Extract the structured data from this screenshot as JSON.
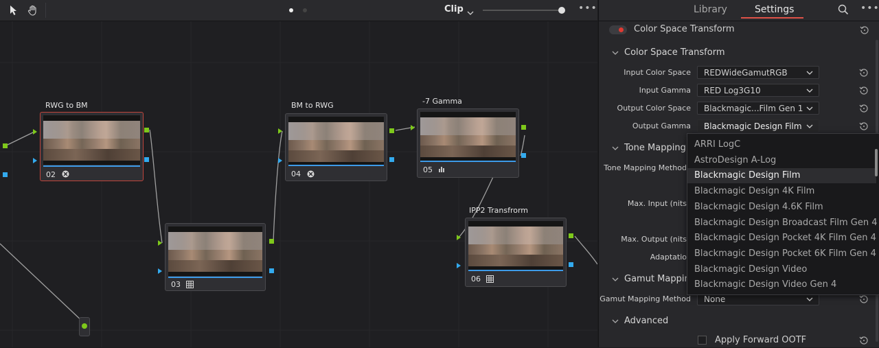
{
  "node_editor": {
    "clip_label": "Clip",
    "more": "•••",
    "nodes": [
      {
        "title": "RWG to BM",
        "number": "02",
        "icon": "fx-icon"
      },
      {
        "title": "",
        "number": "03",
        "icon": "grid-icon"
      },
      {
        "title": "BM to RWG",
        "number": "04",
        "icon": "fx-icon"
      },
      {
        "title": "-7 Gamma",
        "number": "05",
        "icon": "bars-icon"
      },
      {
        "title": "IPP2 Transfrorm",
        "number": "06",
        "icon": "grid-icon"
      }
    ]
  },
  "settings": {
    "tabs": {
      "library": "Library",
      "settings": "Settings"
    },
    "more": "•••",
    "plugin_title": "Color Space Transform",
    "section_cst": "Color Space Transform",
    "input_color_space_label": "Input Color Space",
    "input_color_space_value": "REDWideGamutRGB",
    "input_gamma_label": "Input Gamma",
    "input_gamma_value": "RED Log3G10",
    "output_color_space_label": "Output Color Space",
    "output_color_space_value": "Blackmagic...Film Gen 1",
    "output_gamma_label": "Output Gamma",
    "output_gamma_value": "Blackmagic Design Film",
    "section_tone": "Tone Mapping",
    "tone_method_label": "Tone Mapping Method",
    "max_input_label": "Max. Input (nits",
    "max_output_label": "Max. Output (nits",
    "adaptation_label": "Adaptatio",
    "section_gamut": "Gamut Mapping",
    "gamut_method_label": "Gamut Mapping Method",
    "gamut_method_value": "None",
    "section_advanced": "Advanced",
    "apply_forward_ootf": "Apply Forward OOTF"
  },
  "dropdown": {
    "items": [
      "ARRI LogC",
      "AstroDesign A-Log",
      "Blackmagic Design Film",
      "Blackmagic Design 4K Film",
      "Blackmagic Design 4.6K Film",
      "Blackmagic Design Broadcast Film Gen 4",
      "Blackmagic Design Pocket 4K Film Gen 4",
      "Blackmagic Design Pocket 6K Film Gen 4",
      "Blackmagic Design Video",
      "Blackmagic Design Video Gen 4"
    ],
    "selected_index": 2
  },
  "colors": {
    "accent_red": "#e05248",
    "port_green": "#7ec81b",
    "port_blue": "#33aaee",
    "selected_node_border": "#c0453c"
  }
}
